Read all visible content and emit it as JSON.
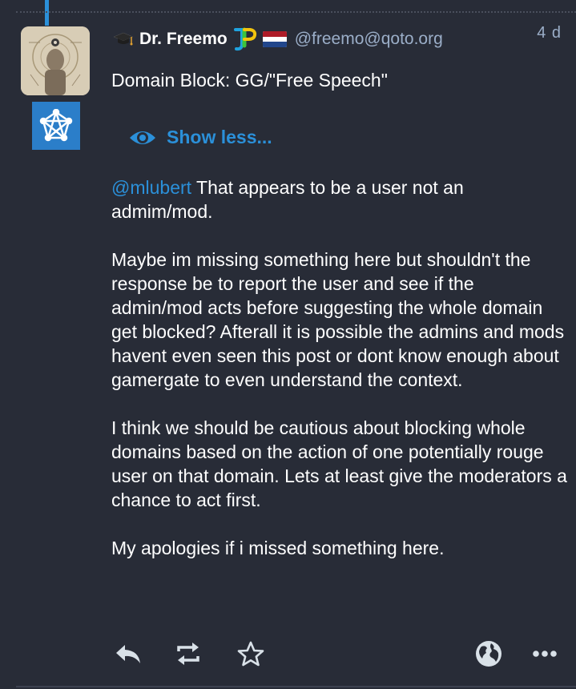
{
  "status": {
    "display_name": "Dr. Freemo",
    "acct": "@freemo@qoto.org",
    "timestamp": "4 d",
    "spoiler_text": "Domain Block: GG/\"Free Speech\"",
    "show_less_label": "Show less...",
    "mention": "@mlubert",
    "paragraphs": [
      " That appears to be a user not an admim/mod.",
      "Maybe im missing something here but shouldn't the response be to report the user and see if the admin/mod acts before suggesting the whole domain get blocked? Afterall it is possible the admins and mods havent even seen this post or dont know enough about gamergate to even understand the context.",
      "I think we should be cautious about blocking whole domains based on the action of one potentially rouge user on that domain. Lets at least give the moderators a chance to act first.",
      "My apologies if i missed something here."
    ]
  },
  "icons": {
    "name_prefix": "graduation-cap-icon",
    "emoji": "jp-emoji-icon",
    "flag": "netherlands-flag-icon",
    "bot_badge": "network-icon",
    "show_less": "eye-icon",
    "reply": "reply-icon",
    "boost": "boost-icon",
    "favourite": "star-icon",
    "visibility": "globe-icon",
    "more": "more-icon"
  },
  "colors": {
    "background": "#282c37",
    "accent": "#2b90d9",
    "muted": "#9baec8",
    "icon": "#d9e1e8"
  }
}
